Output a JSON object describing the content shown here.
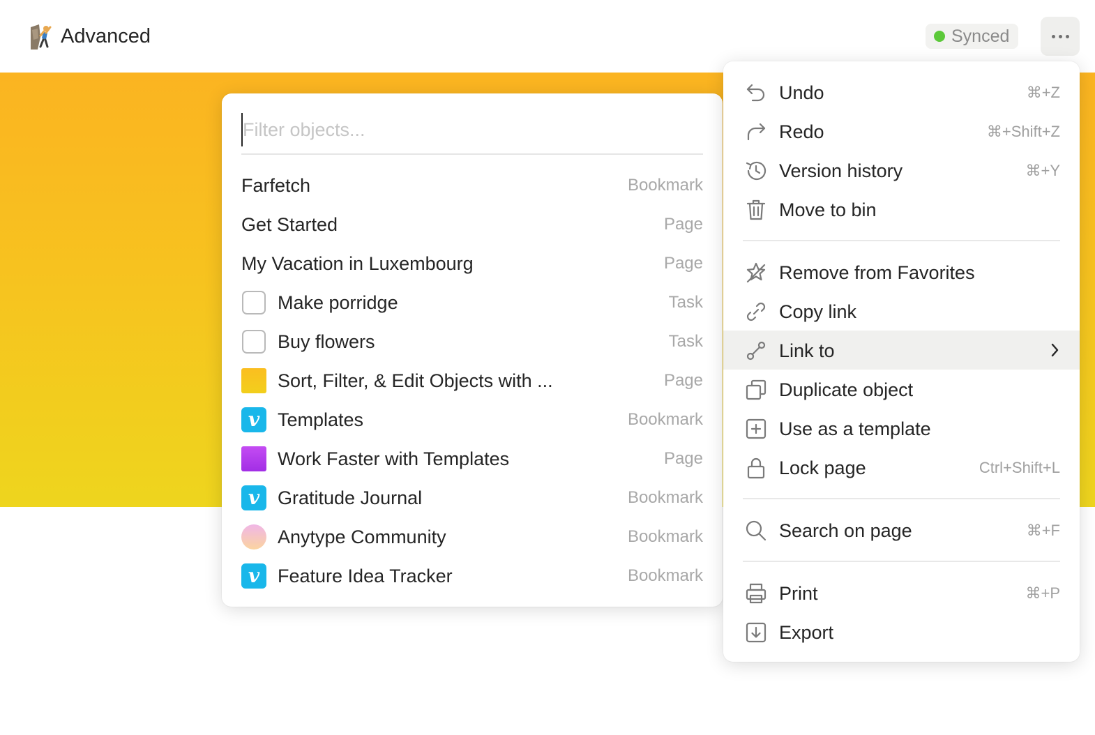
{
  "header": {
    "title": "Advanced",
    "page_icon": "rock-climber-emoji-icon",
    "sync_status": "Synced",
    "sync_color": "#5cc93a",
    "more_icon": "ellipsis-icon"
  },
  "cover": {
    "gradient_top": "#fbb421",
    "gradient_bottom": "#eed51e"
  },
  "filter_popup": {
    "placeholder": "Filter objects...",
    "value": "",
    "objects": [
      {
        "name": "Farfetch",
        "type": "Bookmark",
        "icon": "none"
      },
      {
        "name": "Get Started",
        "type": "Page",
        "icon": "none"
      },
      {
        "name": "My Vacation in Luxembourg",
        "type": "Page",
        "icon": "none"
      },
      {
        "name": "Make porridge",
        "type": "Task",
        "icon": "checkbox-icon"
      },
      {
        "name": "Buy flowers",
        "type": "Task",
        "icon": "checkbox-icon"
      },
      {
        "name": "Sort, Filter, & Edit Objects with ...",
        "type": "Page",
        "icon": "yellow-square-icon"
      },
      {
        "name": "Templates",
        "type": "Bookmark",
        "icon": "vimeo-icon"
      },
      {
        "name": "Work Faster with Templates",
        "type": "Page",
        "icon": "purple-square-icon"
      },
      {
        "name": "Gratitude Journal",
        "type": "Bookmark",
        "icon": "vimeo-icon"
      },
      {
        "name": "Anytype Community",
        "type": "Bookmark",
        "icon": "gradient-circle-icon"
      },
      {
        "name": "Feature Idea Tracker",
        "type": "Bookmark",
        "icon": "vimeo-icon"
      }
    ],
    "vimeo_glyph": "v"
  },
  "context_menu": {
    "items": [
      {
        "label": "Undo",
        "shortcut": "⌘+Z",
        "icon": "undo-icon"
      },
      {
        "label": "Redo",
        "shortcut": "⌘+Shift+Z",
        "icon": "redo-icon"
      },
      {
        "label": "Version history",
        "shortcut": "⌘+Y",
        "icon": "history-icon"
      },
      {
        "label": "Move to bin",
        "shortcut": "",
        "icon": "trash-icon"
      },
      {
        "label": "Remove from Favorites",
        "shortcut": "",
        "icon": "star-off-icon"
      },
      {
        "label": "Copy link",
        "shortcut": "",
        "icon": "link-icon"
      },
      {
        "label": "Link to",
        "shortcut": "",
        "icon": "relation-link-icon",
        "submenu": true,
        "highlighted": true
      },
      {
        "label": "Duplicate object",
        "shortcut": "",
        "icon": "duplicate-icon"
      },
      {
        "label": "Use as a template",
        "shortcut": "",
        "icon": "template-add-icon"
      },
      {
        "label": "Lock page",
        "shortcut": "Ctrl+Shift+L",
        "icon": "lock-icon"
      },
      {
        "label": "Search on page",
        "shortcut": "⌘+F",
        "icon": "search-icon"
      },
      {
        "label": "Print",
        "shortcut": "⌘+P",
        "icon": "printer-icon"
      },
      {
        "label": "Export",
        "shortcut": "",
        "icon": "export-icon"
      }
    ]
  }
}
